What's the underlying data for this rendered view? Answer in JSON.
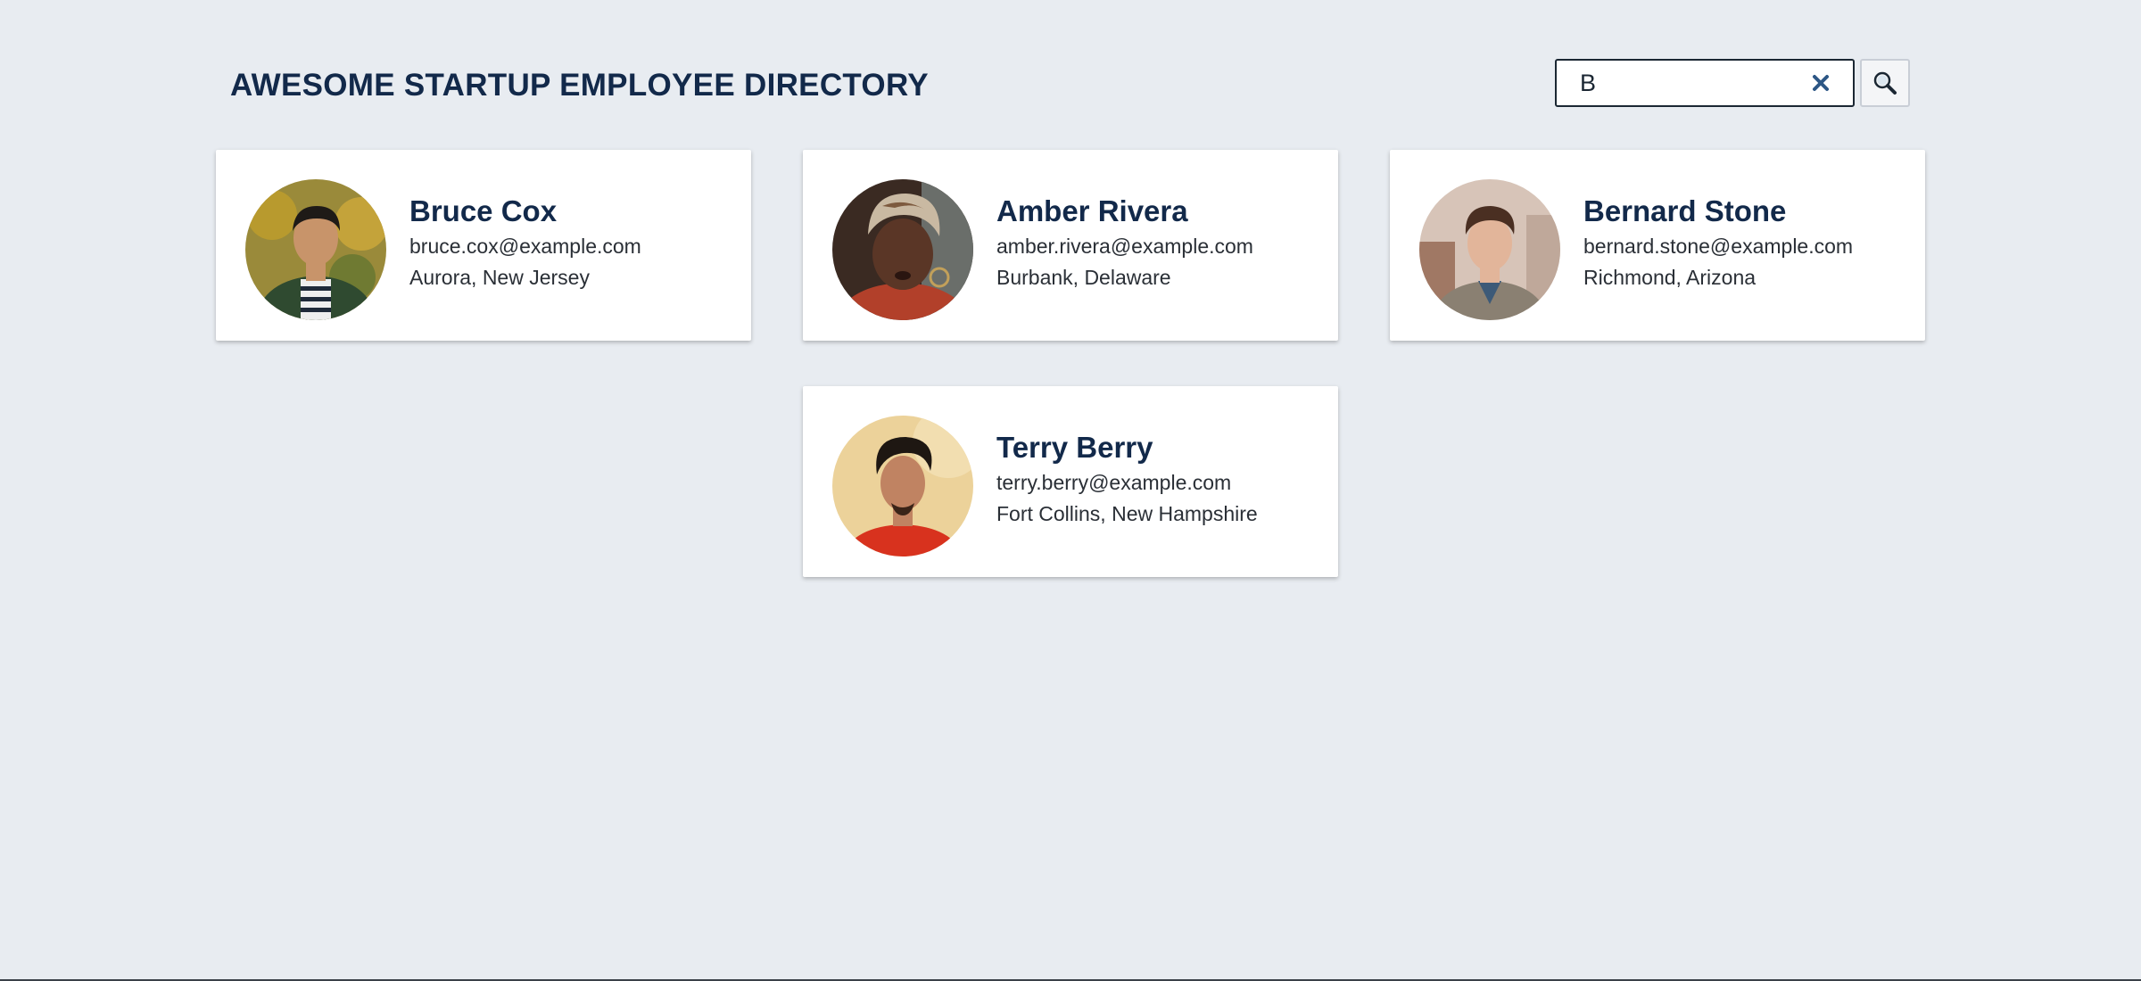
{
  "header": {
    "title": "AWESOME STARTUP EMPLOYEE DIRECTORY"
  },
  "search": {
    "value": "B",
    "clear_icon": "close-icon",
    "button_icon": "magnifier-icon"
  },
  "employees": [
    {
      "name": "Bruce Cox",
      "email": "bruce.cox@example.com",
      "location": "Aurora, New Jersey",
      "avatar_colors": {
        "bg": "#9a8a3a",
        "skin": "#c8946a",
        "hair": "#1e1a17",
        "shirt": "#2f4a30"
      }
    },
    {
      "name": "Amber Rivera",
      "email": "amber.rivera@example.com",
      "location": "Burbank, Delaware",
      "avatar_colors": {
        "bg": "#3a2a22",
        "skin": "#5a3626",
        "hair": "#c9b9a2",
        "shirt": "#b2402a"
      }
    },
    {
      "name": "Bernard Stone",
      "email": "bernard.stone@example.com",
      "location": "Richmond, Arizona",
      "avatar_colors": {
        "bg": "#d7c4b8",
        "skin": "#e2b59a",
        "hair": "#4a2f22",
        "shirt": "#8a8072"
      }
    },
    {
      "name": "Terry Berry",
      "email": "terry.berry@example.com",
      "location": "Fort Collins, New Hampshire",
      "avatar_colors": {
        "bg": "#ecd29a",
        "skin": "#c08362",
        "hair": "#1e1712",
        "shirt": "#d8321e"
      }
    }
  ],
  "colors": {
    "background": "#e8ecf1",
    "title": "#12294a",
    "clear_icon": "#2d5785"
  }
}
